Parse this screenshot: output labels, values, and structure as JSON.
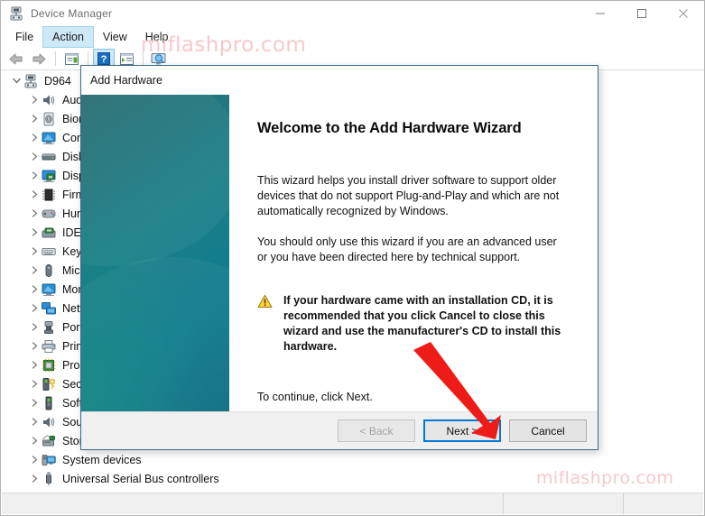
{
  "window": {
    "title": "Device Manager",
    "icon": "device-manager-icon",
    "minimize": "—",
    "maximize": "□",
    "close": "✕"
  },
  "menubar": {
    "items": [
      {
        "label": "File",
        "active": false
      },
      {
        "label": "Action",
        "active": true
      },
      {
        "label": "View",
        "active": false
      },
      {
        "label": "Help",
        "active": false
      }
    ]
  },
  "toolbar": {
    "buttons": [
      {
        "name": "back-icon",
        "selected": false
      },
      {
        "name": "forward-icon",
        "selected": false
      },
      {
        "name": "separator",
        "selected": false
      },
      {
        "name": "properties-icon",
        "selected": false
      },
      {
        "name": "separator",
        "selected": false
      },
      {
        "name": "help-icon",
        "selected": true
      },
      {
        "name": "update-driver-icon",
        "selected": false
      },
      {
        "name": "separator",
        "selected": false
      },
      {
        "name": "scan-hardware-changes-icon",
        "selected": false
      }
    ]
  },
  "tree": {
    "root": {
      "label": "D964",
      "icon": "computer-icon",
      "expanded": true
    },
    "items": [
      {
        "label": "Audio inputs and outputs",
        "icon": "speaker-icon"
      },
      {
        "label": "Biometric devices",
        "icon": "fingerprint-icon"
      },
      {
        "label": "Computer",
        "icon": "monitor-icon"
      },
      {
        "label": "Disk drives",
        "icon": "disk-drive-icon"
      },
      {
        "label": "Display adapters",
        "icon": "display-adapter-icon"
      },
      {
        "label": "Firmware",
        "icon": "chip-icon"
      },
      {
        "label": "Human Interface Devices",
        "icon": "hid-icon"
      },
      {
        "label": "IDE ATA/ATAPI controllers",
        "icon": "ide-controller-icon"
      },
      {
        "label": "Keyboards",
        "icon": "keyboard-icon"
      },
      {
        "label": "Mice and other pointing devices",
        "icon": "mouse-icon"
      },
      {
        "label": "Monitors",
        "icon": "monitor-icon"
      },
      {
        "label": "Network adapters",
        "icon": "network-adapter-icon"
      },
      {
        "label": "Portable Devices",
        "icon": "portable-device-icon"
      },
      {
        "label": "Print queues",
        "icon": "printer-icon"
      },
      {
        "label": "Processors",
        "icon": "processor-icon"
      },
      {
        "label": "Security devices",
        "icon": "security-device-icon"
      },
      {
        "label": "Software devices",
        "icon": "software-device-icon"
      },
      {
        "label": "Sound, video and game controllers",
        "icon": "speaker-icon"
      },
      {
        "label": "Storage controllers",
        "icon": "storage-controller-icon"
      },
      {
        "label": "System devices",
        "icon": "system-device-icon"
      },
      {
        "label": "Universal Serial Bus controllers",
        "icon": "usb-icon"
      }
    ]
  },
  "statusbar": {
    "panes": [
      "",
      "",
      ""
    ]
  },
  "watermark": {
    "top": "miflashpro.com",
    "bottom": "miflashpro.com"
  },
  "dialog": {
    "title": "Add Hardware",
    "heading": "Welcome to the Add Hardware Wizard",
    "paragraph1": "This wizard helps you install driver software to support older devices that do not support Plug-and-Play and which are not automatically recognized by Windows.",
    "paragraph2": "You should only use this wizard if you are an advanced user or you have been directed here by technical support.",
    "warning_icon": "warning-triangle-icon",
    "warning": "If your hardware came with an installation CD, it is recommended that you click Cancel to close this wizard and use the manufacturer's CD to install this hardware.",
    "continue": "To continue, click Next.",
    "buttons": {
      "back": "< Back",
      "next": "Next >",
      "cancel": "Cancel"
    }
  },
  "annotation": {
    "arrow_color": "#EE1C18",
    "arrow_target": "next-button"
  }
}
